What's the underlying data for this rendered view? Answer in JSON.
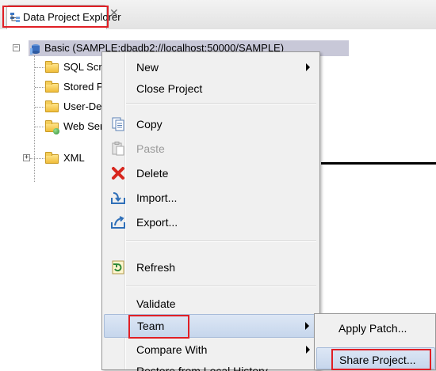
{
  "view": {
    "tab_label": "Data Project Explorer",
    "close_glyph": "✕"
  },
  "tree": {
    "project_label": "Basic (SAMPLE:dbadb2://localhost:50000/SAMPLE)",
    "children": [
      {
        "label": "SQL Scripts",
        "icon": "folder-icon"
      },
      {
        "label": "Stored Procedures",
        "icon": "folder-icon"
      },
      {
        "label": "User-Defined Functions",
        "icon": "folder-icon"
      },
      {
        "label": "Web Services",
        "icon": "web-folder-icon"
      },
      {
        "label": "XML",
        "icon": "folder-icon"
      }
    ]
  },
  "context_menu": {
    "items": {
      "new": "New",
      "close_project": "Close Project",
      "copy": "Copy",
      "paste": "Paste",
      "delete": "Delete",
      "import": "Import...",
      "export": "Export...",
      "refresh": "Refresh",
      "validate": "Validate",
      "team": "Team",
      "compare_with": "Compare With"
    },
    "cut_off_text": "Restore from Local History..."
  },
  "team_submenu": {
    "apply_patch": "Apply Patch...",
    "share_project": "Share Project..."
  },
  "colors": {
    "highlight_box": "#e01f25",
    "selection": "#c8c8d8",
    "menu_bg": "#f0f0f0"
  }
}
